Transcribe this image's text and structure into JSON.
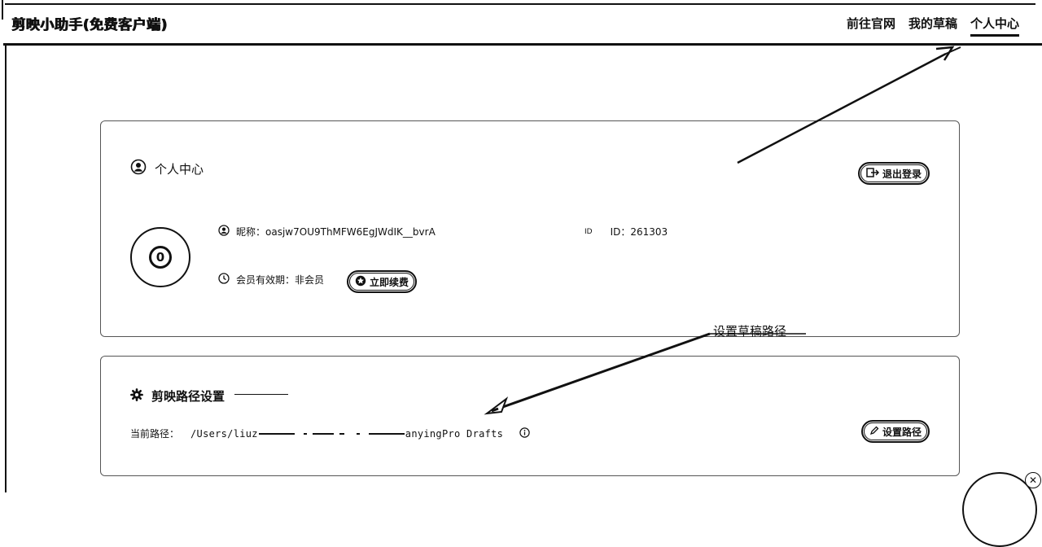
{
  "app": {
    "title": "剪映小助手(免费客户端)"
  },
  "nav": [
    {
      "label": "前往官网",
      "active": false
    },
    {
      "label": "我的草稿",
      "active": false
    },
    {
      "label": "个人中心",
      "active": true
    }
  ],
  "profile": {
    "title": "个人中心",
    "logout_label": "退出登录",
    "nickname_label": "昵称：",
    "nickname": "oasjw7OU9ThMFW6EgJWdIK__bvrA",
    "id_tag": "ID",
    "id_label": "ID：",
    "id_value": "261303",
    "member_label": "会员有效期：",
    "member_value": "非会员",
    "renew_label": "立即续费"
  },
  "path_settings": {
    "title": "剪映路径设置",
    "current_label": "当前路径：",
    "path_start": "/Users/liuz",
    "path_end": "anyingPro Drafts",
    "set_path_label": "设置路径"
  },
  "annotations": {
    "set_path_callout": "设置草稿路径"
  }
}
